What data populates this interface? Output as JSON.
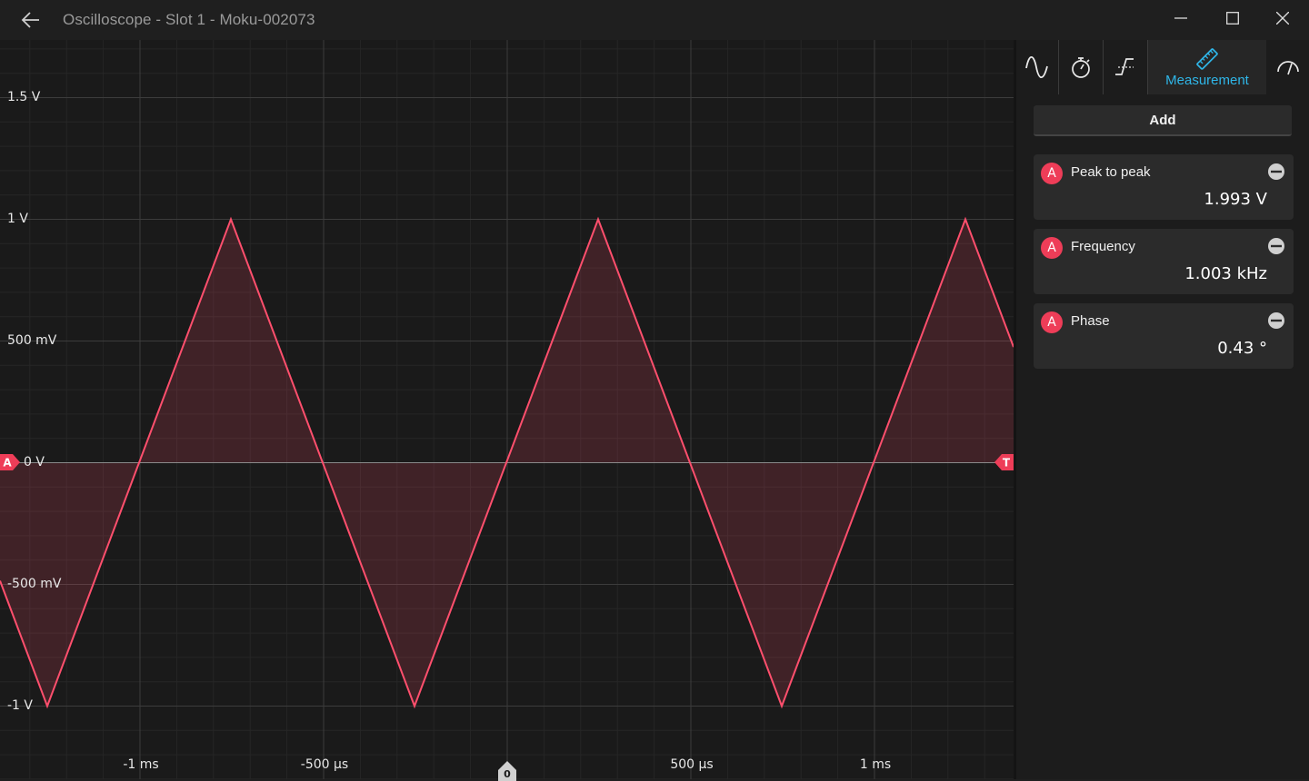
{
  "window": {
    "title": "Oscilloscope - Slot 1 - Moku-002073"
  },
  "plot": {
    "y_labels": [
      "1.5 V",
      "1 V",
      "500 mV",
      "0 V",
      "-500 mV",
      "-1 V"
    ],
    "x_labels": [
      "-1 ms",
      "-500 µs",
      "500 µs",
      "1 ms"
    ],
    "channel_marker": "A",
    "trigger_marker": "T",
    "time_zero_marker": "0",
    "trace_color": "#ff4f6d"
  },
  "panel": {
    "tabs": [
      {
        "icon": "sine-wave-icon"
      },
      {
        "icon": "stopwatch-icon"
      },
      {
        "icon": "trigger-edge-icon"
      },
      {
        "icon": "ruler-icon",
        "label": "Measurement",
        "active": true
      },
      {
        "icon": "gauge-icon"
      }
    ],
    "add_label": "Add",
    "measurements": [
      {
        "channel": "A",
        "name": "Peak to peak",
        "value": "1.993 V"
      },
      {
        "channel": "A",
        "name": "Frequency",
        "value": "1.003 kHz"
      },
      {
        "channel": "A",
        "name": "Phase",
        "value": "0.43 °"
      }
    ]
  },
  "colors": {
    "accent": "#2fb6e8",
    "channel_a": "#ee3d58",
    "background": "#1f1f1f"
  }
}
